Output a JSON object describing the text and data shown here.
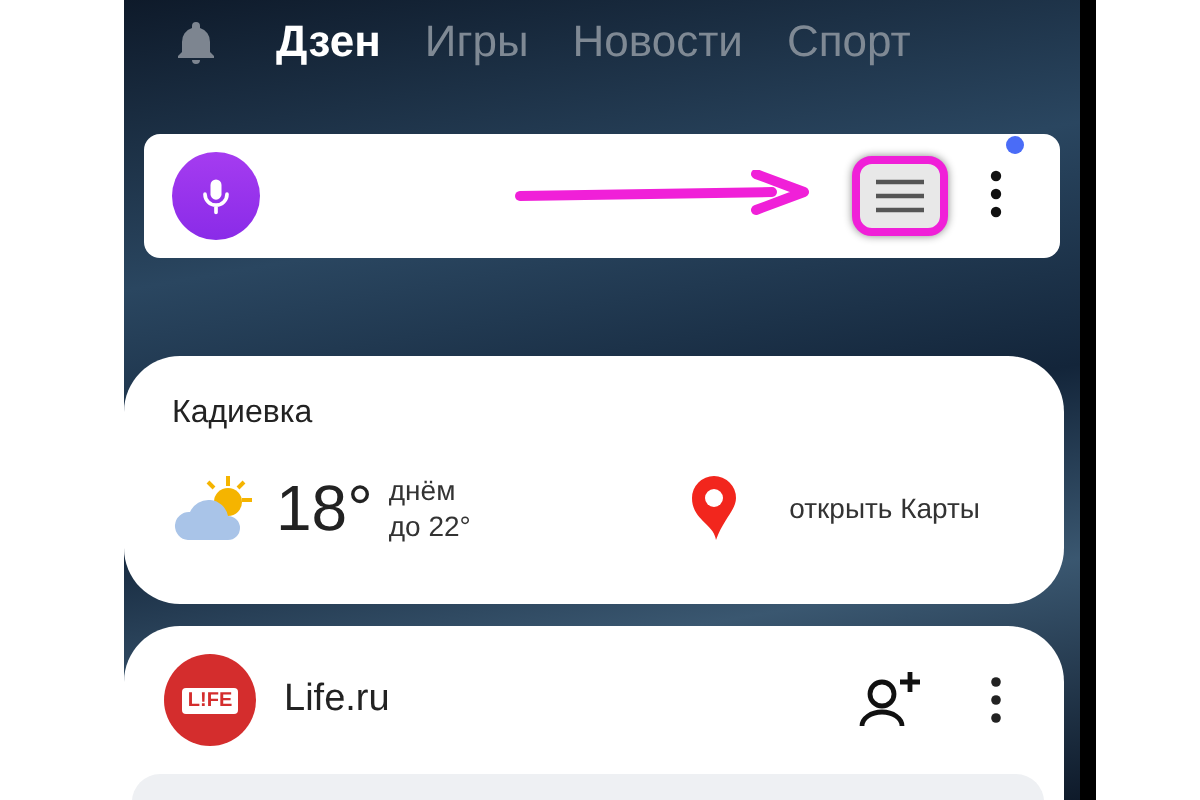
{
  "tabs": [
    {
      "label": "Дзен",
      "selected": true
    },
    {
      "label": "Игры",
      "selected": false
    },
    {
      "label": "Новости",
      "selected": false
    },
    {
      "label": "Спорт",
      "selected": false
    }
  ],
  "search_bar": {
    "menu_highlighted": true,
    "more_notification": true
  },
  "weather_card": {
    "city": "Кадиевка",
    "temperature": "18°",
    "period": "днём",
    "forecast": "до 22°",
    "maps_link": "открыть Карты"
  },
  "feed_card": {
    "logo": "L!FE",
    "source": "Life.ru"
  }
}
